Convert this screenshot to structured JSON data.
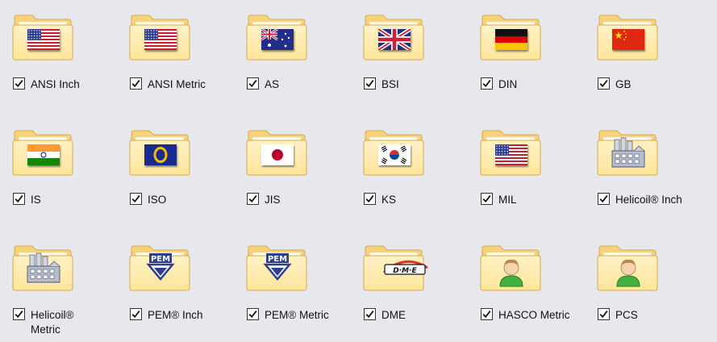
{
  "items": [
    {
      "label": "ANSI Inch",
      "icon": "us-flag-icon",
      "checked": true
    },
    {
      "label": "ANSI Metric",
      "icon": "us-flag-icon",
      "checked": true
    },
    {
      "label": "AS",
      "icon": "australia-flag-icon",
      "checked": true
    },
    {
      "label": "BSI",
      "icon": "uk-flag-icon",
      "checked": true
    },
    {
      "label": "DIN",
      "icon": "germany-flag-icon",
      "checked": true
    },
    {
      "label": "GB",
      "icon": "china-flag-icon",
      "checked": true
    },
    {
      "label": "IS",
      "icon": "india-flag-icon",
      "checked": true
    },
    {
      "label": "ISO",
      "icon": "iso-logo-icon",
      "checked": true
    },
    {
      "label": "JIS",
      "icon": "japan-flag-icon",
      "checked": true
    },
    {
      "label": "KS",
      "icon": "korea-flag-icon",
      "checked": true
    },
    {
      "label": "MIL",
      "icon": "us-flag-icon",
      "checked": true
    },
    {
      "label": "Helicoil® Inch",
      "icon": "factory-icon",
      "checked": true
    },
    {
      "label": "Helicoil® Metric",
      "icon": "factory-icon",
      "checked": true
    },
    {
      "label": "PEM® Inch",
      "icon": "pem-logo-icon",
      "checked": true
    },
    {
      "label": "PEM® Metric",
      "icon": "pem-logo-icon",
      "checked": true
    },
    {
      "label": "DME",
      "icon": "dme-logo-icon",
      "checked": true
    },
    {
      "label": "HASCO Metric",
      "icon": "user-icon",
      "checked": true
    },
    {
      "label": "PCS",
      "icon": "user-icon",
      "checked": true
    }
  ],
  "colors": {
    "background": "#e6e8ee",
    "folder_back": "#f2c96a",
    "folder_front": "#fde59a",
    "folder_edge": "#d9a84a"
  },
  "flag_texts": {
    "pem": "PEM",
    "dme": "D·M·E"
  }
}
